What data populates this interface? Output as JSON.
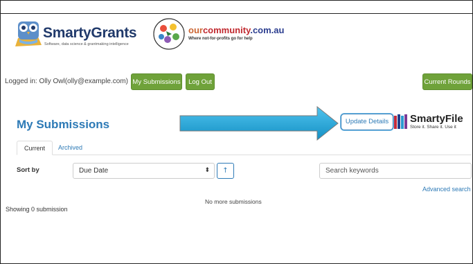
{
  "header": {
    "smartygrants": {
      "name": "SmartyGrants",
      "tagline": "Software, data science & grantmaking intelligence"
    },
    "ourcommunity": {
      "name_part1": "our",
      "name_part2": "community",
      "name_part3": ".com.au",
      "tagline": "Where not-for-profits go for help"
    }
  },
  "user_bar": {
    "logged_in_text": "Logged in: Olly Owl(olly@example.com)",
    "my_submissions_label": "My Submissions",
    "log_out_label": "Log Out",
    "current_rounds_label": "Current Rounds"
  },
  "main": {
    "title": "My Submissions",
    "update_details_label": "Update Details",
    "smartyfile": {
      "name": "SmartyFile",
      "tagline": "Store it. Share it. Use it"
    },
    "tabs": [
      {
        "label": "Current",
        "active": true
      },
      {
        "label": "Archived",
        "active": false
      }
    ],
    "sort": {
      "label": "Sort by",
      "selected": "Due Date",
      "caret": "⬍",
      "direction_icon": "↑"
    },
    "search": {
      "placeholder": "Search keywords"
    },
    "advanced_search_label": "Advanced search",
    "no_more_text": "No more submissions",
    "showing_text": "Showing 0 submission"
  },
  "colors": {
    "green": "#6fa23a",
    "blue": "#2d7ab6",
    "arrow": "#1aa3d6"
  }
}
